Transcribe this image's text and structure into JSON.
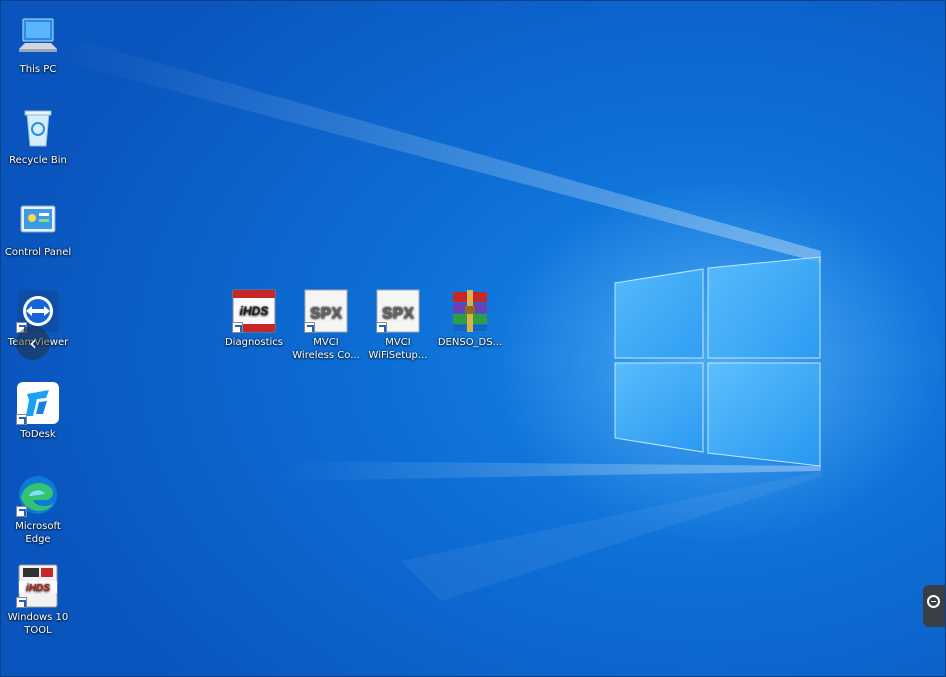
{
  "desktop": {
    "left_icons": [
      {
        "name": "this-pc-icon",
        "label": "This PC"
      },
      {
        "name": "recycle-bin-icon",
        "label": "Recycle Bin"
      },
      {
        "name": "control-panel-icon",
        "label": "Control Panel"
      },
      {
        "name": "teamviewer-icon",
        "label": "TeamViewer"
      },
      {
        "name": "todesk-icon",
        "label": "ToDesk"
      },
      {
        "name": "microsoft-edge-icon",
        "label": "Microsoft Edge"
      },
      {
        "name": "windows10-tool-icon",
        "label": "Windows 10 TOOL"
      }
    ],
    "center_icons": [
      {
        "name": "diagnostics-icon",
        "label": "Diagnostics",
        "logo": "iHDS"
      },
      {
        "name": "mvci-wireless-icon",
        "label": "MVCI Wireless Co...",
        "logo": "SPX"
      },
      {
        "name": "mvci-wifisetup-icon",
        "label": "MVCI WiFiSetup...",
        "logo": "SPX"
      },
      {
        "name": "denso-ds-icon",
        "label": "DENSO_DS..."
      }
    ],
    "windows10_tool_logo": "iHDS"
  },
  "colors": {
    "wallpaper_dark": "#0a55bd",
    "wallpaper_light": "#1a86e6",
    "logo_glow": "#8fd3ff"
  }
}
